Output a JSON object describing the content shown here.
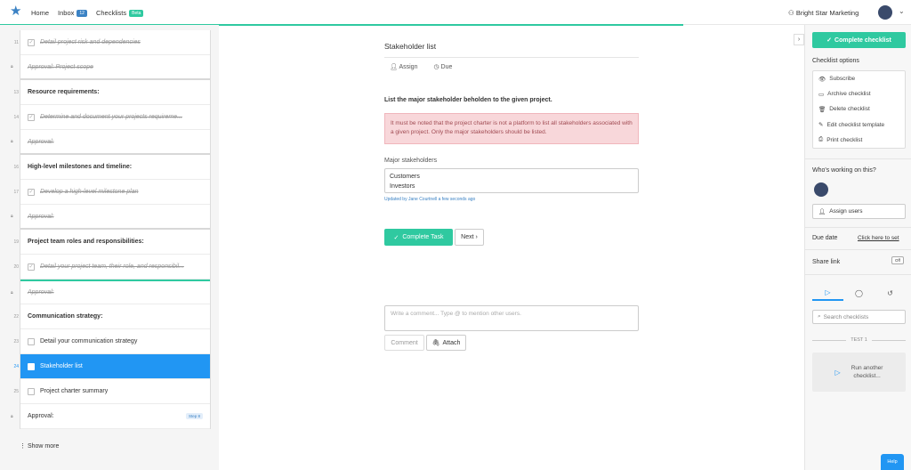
{
  "nav": {
    "home": "Home",
    "inbox": "Inbox",
    "inbox_count": "12",
    "checklists": "Checklists",
    "checklists_badge": "Beta",
    "org_name": "Bright Star Marketing"
  },
  "tasks": [
    {
      "num": "11",
      "text": "Detail project risk and dependencies",
      "type": "done"
    },
    {
      "num": "",
      "text": "Approval: Project scope",
      "type": "approval"
    },
    {
      "num": "13",
      "text": "Resource requirements:",
      "type": "heading"
    },
    {
      "num": "14",
      "text": "Determine and document your projects requireme...",
      "type": "done"
    },
    {
      "num": "",
      "text": "Approval:",
      "type": "approval"
    },
    {
      "num": "16",
      "text": "High-level milestones and timeline:",
      "type": "heading"
    },
    {
      "num": "17",
      "text": "Develop a high-level milestone plan",
      "type": "done"
    },
    {
      "num": "",
      "text": "Approval:",
      "type": "approval"
    },
    {
      "num": "19",
      "text": "Project team roles and responsibilities:",
      "type": "heading"
    },
    {
      "num": "20",
      "text": "Detail your project team, their role, and responsibil...",
      "type": "done"
    },
    {
      "num": "",
      "text": "Approval:",
      "type": "approval"
    },
    {
      "num": "22",
      "text": "Communication strategy:",
      "type": "heading"
    },
    {
      "num": "23",
      "text": "Detail your communication strategy",
      "type": "todo"
    },
    {
      "num": "24",
      "text": "Stakeholder list",
      "type": "active"
    },
    {
      "num": "25",
      "text": "Project charter summary",
      "type": "todo"
    },
    {
      "num": "",
      "text": "Approval:",
      "type": "approval-open",
      "badge": "Step 8"
    }
  ],
  "show_more": "Show more",
  "main": {
    "title": "Stakeholder list",
    "assign": "Assign",
    "due": "Due",
    "description": "List the major stakeholder beholden to the given project.",
    "alert": "It must be noted that the project charter is not a platform to list all stakeholders associated with a given project. Only the major stakeholders should be listed.",
    "field_label": "Major stakeholders",
    "field_value_1": "Customers",
    "field_value_2": "Investors",
    "updated": "Updated by Jane Courtnell a few seconds ago",
    "complete_btn": "Complete Task",
    "next_btn": "Next",
    "comment_placeholder": "Write a comment... Type @ to mention other users.",
    "comment_btn": "Comment",
    "attach_btn": "Attach"
  },
  "right": {
    "complete_checklist": "Complete checklist",
    "options_title": "Checklist options",
    "options": [
      "Subscribe",
      "Archive checklist",
      "Delete checklist",
      "Edit checklist template",
      "Print checklist"
    ],
    "working_title": "Who's working on this?",
    "assign_users": "Assign users",
    "due_date": "Due date",
    "due_link": "Click here to set",
    "share_link": "Share link",
    "share_state": "Off",
    "search_placeholder": "Search checklists",
    "test_label": "TEST 1",
    "run_line1": "Run another",
    "run_line2": "checklist...",
    "help": "Help"
  }
}
